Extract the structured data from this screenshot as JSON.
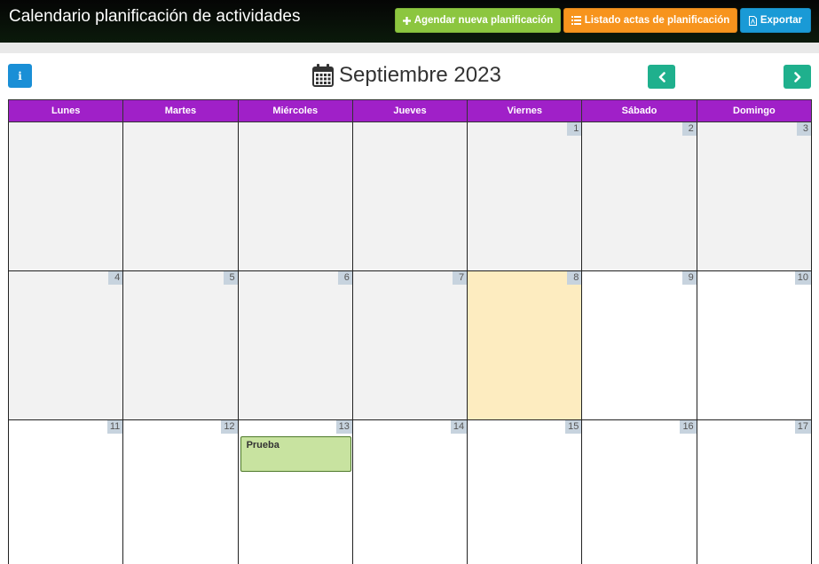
{
  "header": {
    "title": "Calendario planificación de actividades",
    "buttons": {
      "agendar": "Agendar nueva planificación",
      "listado": "Listado actas de planificación",
      "exportar": "Exportar"
    }
  },
  "calendar": {
    "info_label": "i",
    "month_title": "Septiembre 2023",
    "weekdays": [
      "Lunes",
      "Martes",
      "Miércoles",
      "Jueves",
      "Viernes",
      "Sábado",
      "Domingo"
    ],
    "weeks": [
      [
        "",
        "",
        "",
        "",
        "1",
        "2",
        "3"
      ],
      [
        "4",
        "5",
        "6",
        "7",
        "8",
        "9",
        "10"
      ],
      [
        "11",
        "12",
        "13",
        "14",
        "15",
        "16",
        "17"
      ]
    ],
    "events": [
      {
        "day": "13",
        "title": "Prueba"
      }
    ]
  },
  "colors": {
    "header_bg": "#050505",
    "agendar_btn": "#8cc63f",
    "listado_btn": "#f7941d",
    "exportar_btn": "#1a9ad6",
    "weekday_header": "#a020c8",
    "nav_btn": "#1fb08d",
    "today_cell": "#fdecc0",
    "event_bg": "#c8e3a0"
  },
  "icons": {
    "agendar": "plus-icon",
    "listado": "list-icon",
    "exportar": "pdf-file-icon",
    "month": "calendar-icon",
    "prev": "chevron-left-icon",
    "next": "chevron-right-icon"
  }
}
